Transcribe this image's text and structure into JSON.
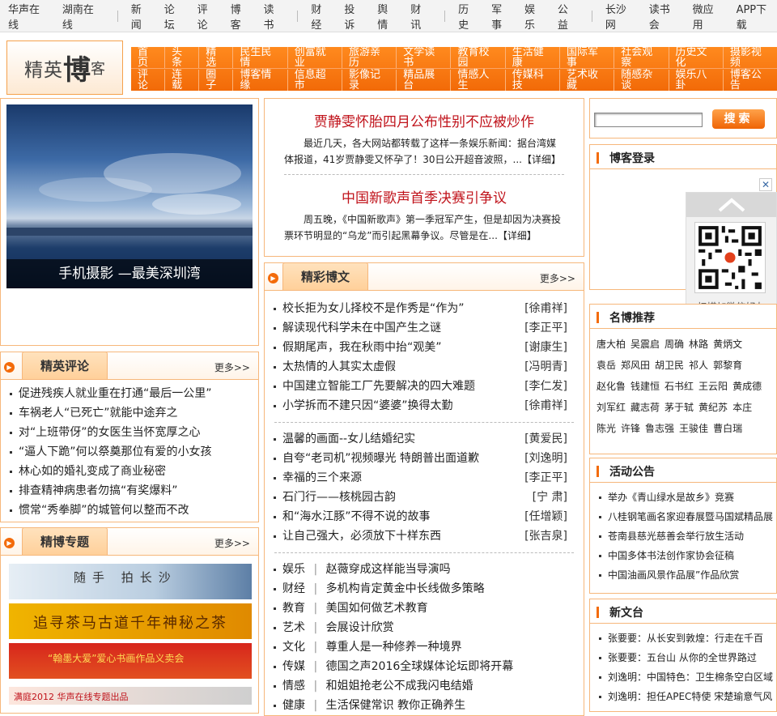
{
  "topbar": {
    "group1": [
      "华声在线",
      "湖南在线"
    ],
    "group2": [
      "新闻",
      "论坛",
      "评论",
      "博客",
      "读书"
    ],
    "group3": [
      "财经",
      "投诉",
      "舆情",
      "财讯"
    ],
    "group4": [
      "历史",
      "军事",
      "娱乐",
      "公益"
    ],
    "group5": [
      "长沙网",
      "读书会",
      "微应用",
      "APP下载"
    ]
  },
  "logo": {
    "small": "精英",
    "big": "博",
    "tail": "客"
  },
  "nav": {
    "row1": [
      "首页",
      "头条",
      "精选",
      "民生民情",
      "创富就业",
      "旅游亲历",
      "文学读书",
      "教育校园",
      "生活健康",
      "国际军事",
      "社会观察",
      "历史文化",
      "摄影视频"
    ],
    "row2": [
      "评论",
      "连载",
      "圈子",
      "博客情缘",
      "信息超市",
      "影像记录",
      "精品展台",
      "情感人生",
      "传媒科技",
      "艺术收藏",
      "随感杂谈",
      "娱乐八卦",
      "博客公告"
    ]
  },
  "photo": {
    "caption": "手机摄影 —最美深圳湾"
  },
  "news": [
    {
      "title": "贾静雯怀胎四月公布性别不应被炒作",
      "text": "最近几天，各大网站都转载了这样一条娱乐新闻：据台湾媒体报道，41岁贾静雯又怀孕了！30日公开超音波照，...【详细】"
    },
    {
      "title": "中国新歌声首季决赛引争议",
      "text": "周五晚，《中国新歌声》第一季冠军产生，但是却因为决赛投票环节明显的“乌龙”而引起黑幕争议。尽管是在...【详细】"
    }
  ],
  "review": {
    "title": "精英评论",
    "more": "更多>>",
    "items": [
      "促进残疾人就业重在打通“最后一公里”",
      "车祸老人“已死亡”就能中途弃之",
      "对“上班带伢”的女医生当怀宽厚之心",
      "“逼人下跪”何以祭奠那位有爱的小女孩",
      "林心如的婚礼变成了商业秘密",
      "排查精神病患者勿搞“有奖爆料”",
      "惯常“秀拳脚”的城管何以整而不改"
    ]
  },
  "topics": {
    "title": "精博专题",
    "more": "更多>>",
    "banners": [
      "随手 拍长沙",
      "追寻茶马古道千年神秘之茶",
      "“翰墨大爱”爱心书画作品义卖会",
      "满庭2012 华声在线专题出品"
    ]
  },
  "articles": {
    "title": "精彩博文",
    "more": "更多>>",
    "group1": [
      {
        "t": "校长拒为女儿择校不是作秀是“作为”",
        "a": "[徐甫祥]"
      },
      {
        "t": "解读现代科学未在中国产生之谜",
        "a": "[李正平]"
      },
      {
        "t": "假期尾声，我在秋雨中抬“观美”",
        "a": "[谢康生]"
      },
      {
        "t": "太热情的人其实太虚假",
        "a": "[冯明青]"
      },
      {
        "t": "中国建立智能工厂先要解决的四大难题",
        "a": "[李仁发]"
      },
      {
        "t": "小学拆而不建只因“婆婆”换得太勤",
        "a": "[徐甫祥]"
      }
    ],
    "group2": [
      {
        "t": "温馨的画面--女儿结婚纪实",
        "a": "[黄爱民]"
      },
      {
        "t": "自夸“老司机”视频曝光 特朗普出面道歉",
        "a": "[刘逸明]"
      },
      {
        "t": "幸福的三个来源",
        "a": "[李正平]"
      },
      {
        "t": "石门行——核桃园古韵",
        "a": "[宁 肃]"
      },
      {
        "t": "和“海水江豚”不得不说的故事",
        "a": "[任增颖]"
      },
      {
        "t": "让自己强大，必须放下十样东西",
        "a": "[张吉泉]"
      }
    ],
    "group3": [
      {
        "c": "娱乐",
        "t": "赵薇穿成这样能当导演吗"
      },
      {
        "c": "财经",
        "t": "多机构肯定黄金中长线做多策略"
      },
      {
        "c": "教育",
        "t": "美国如何做艺术教育"
      },
      {
        "c": "艺术",
        "t": "会展设计欣赏"
      },
      {
        "c": "文化",
        "t": "尊重人是一种修养一种境界"
      },
      {
        "c": "传媒",
        "t": "德国之声2016全球媒体论坛即将开幕"
      },
      {
        "c": "情感",
        "t": "和姐姐抢老公不成我闪电结婚"
      },
      {
        "c": "健康",
        "t": "生活保健常识 教你正确养生"
      }
    ]
  },
  "search": {
    "button": "搜索"
  },
  "login": {
    "title": "博客登录"
  },
  "qr": {
    "caption": "扫描加微信好友"
  },
  "famous": {
    "title": "名博推荐",
    "rows": [
      [
        "唐大柏",
        "吴震启",
        "周确",
        "林路",
        "黄炳文"
      ],
      [
        "袁岳",
        "郑风田",
        "胡卫民",
        "祁人",
        "郭黎育"
      ],
      [
        "赵化鲁",
        "钱建恒",
        "石书红",
        "王云阳",
        "黄成德"
      ],
      [
        "刘军红",
        "藏志荷",
        "茅于轼",
        "黄纪苏",
        "本庄"
      ],
      [
        "陈光",
        "许锋",
        "鲁志强",
        "王骏佳",
        "曹白瑞"
      ]
    ]
  },
  "events": {
    "title": "活动公告",
    "items": [
      "举办《青山绿水是故乡》竞赛",
      "八桂钢笔画名家迎春展暨马国斌精品展",
      "苍南县慈光慈善会举行放生活动",
      "中国多体书法创作家协会征稿",
      "中国油画风景作品展”作品欣赏"
    ]
  },
  "newstage": {
    "title": "新文台",
    "items": [
      "张要要：从长安到敦煌：行走在千百",
      "张要要：五台山 从你的全世界路过",
      "刘逸明：中国特色：卫生棉条空白区域",
      "刘逸明：担任APEC特使 宋楚瑜意气风"
    ]
  },
  "colors": {
    "accent": "#f36b0a",
    "headline": "#c0121a",
    "border": "#f6b77b"
  }
}
